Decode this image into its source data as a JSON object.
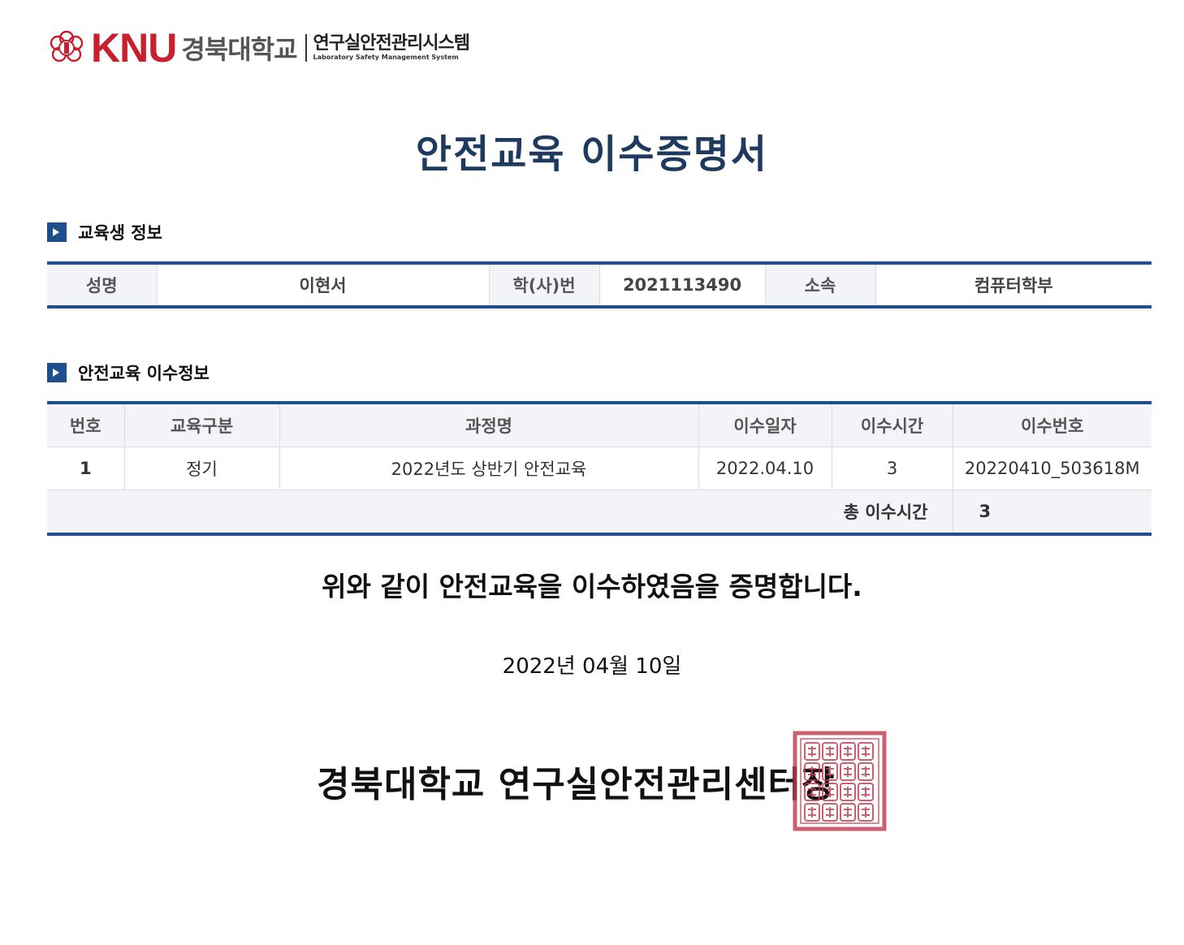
{
  "header": {
    "logo_text": "KNU",
    "university_name": "경북대학교",
    "system_name": "연구실안전관리시스템",
    "system_name_en": "Laboratory Safety Management System",
    "brand_color": "#c8202f"
  },
  "document": {
    "title": "안전교육 이수증명서",
    "title_color": "#1f3a5f"
  },
  "student_section": {
    "heading": "교육생 정보",
    "fields": {
      "name_label": "성명",
      "name_value": "이현서",
      "id_label": "학(사)번",
      "id_value": "2021113490",
      "dept_label": "소속",
      "dept_value": "컴퓨터학부"
    }
  },
  "course_section": {
    "heading": "안전교육 이수정보",
    "columns": [
      "번호",
      "교육구분",
      "과정명",
      "이수일자",
      "이수시간",
      "이수번호"
    ],
    "rows": [
      {
        "no": "1",
        "category": "정기",
        "course": "2022년도 상반기 안전교육",
        "date": "2022.04.10",
        "hours": "3",
        "cert_no": "20220410_503618M"
      }
    ],
    "total_label": "총 이수시간",
    "total_value": "3",
    "accent_color": "#1f4e8c"
  },
  "statement": "위와 같이 안전교육을 이수하였음을 증명합니다.",
  "issue_date": "2022년 04월 10일",
  "issuer": "경북대학교 연구실안전관리센터장",
  "seal": {
    "icon": "official-seal-icon",
    "color": "#c0394f",
    "text": "경북대학교연구실안전관리센터장인"
  }
}
